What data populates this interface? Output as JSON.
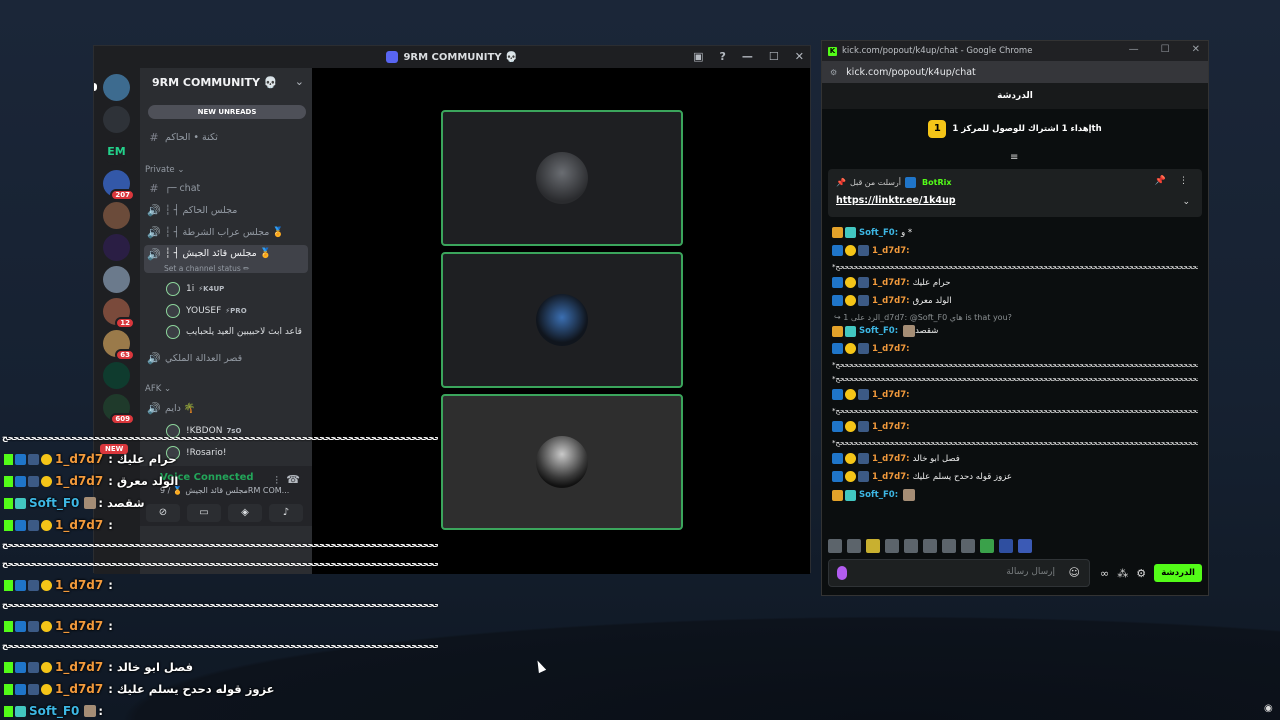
{
  "discord": {
    "window_title": "9RM COMMUNITY 💀",
    "server_name": "9RM COMMUNITY 💀",
    "new_unreads": "NEW UNREADS",
    "guild_badges": [
      "207",
      "12",
      "63",
      "609"
    ],
    "channels_top": [
      {
        "name": "ثكنة • الحاكم",
        "icon": "#"
      }
    ],
    "category_private": "Private ⌄",
    "private_channels": [
      {
        "name": "┌─ chat",
        "icon": "#"
      },
      {
        "name": "┆ ┤ مجلس الحاكم",
        "icon": "🔊"
      },
      {
        "name": "┆ ┤ مجلس عراب الشرطة 🏅",
        "icon": "🔊"
      },
      {
        "name": "┆ ┤ مجلس قائد الجيش 🏅",
        "icon": "🔊"
      }
    ],
    "active_status": "Set a channel status ✏",
    "voice_users": [
      {
        "name": "1i",
        "tag": "⚡K4UP"
      },
      {
        "name": "YOUSEF",
        "tag": "⚡PRO"
      },
      {
        "name": "قاعد ابث لاحبيبين العيد يلحبايب",
        "tag": ""
      }
    ],
    "other_channel": "قصر العدالة الملكي",
    "category_afk": "AFK ⌄",
    "afk_channel": "دايم 🌴",
    "afk_users": [
      {
        "name": "!KBDON",
        "tag": "7sO"
      },
      {
        "name": "!Rosario!",
        "tag": ""
      }
    ],
    "voice_connected": "Voice Connected",
    "voice_detail": "مجلس قائد الجيش 🏅 / 9RM COM...",
    "new_tag": "NEW"
  },
  "kick": {
    "window_title": "kick.com/popout/k4up/chat - Google Chrome",
    "url": "kick.com/popout/k4up/chat",
    "header": "الدردشة",
    "goal_number": "1",
    "goal_text": "إهداء 1 اشتراك للوصول للمركز 1th",
    "pinned_by": "أرسلت من قبل",
    "pinned_bot": "BotRix",
    "pinned_link": "https://linktr.ee/1k4up",
    "messages": [
      {
        "user": "Soft_F0",
        "type": "soft",
        "text": "و *"
      },
      {
        "user": "1_d7d7",
        "type": "dd",
        "text": ""
      },
      {
        "user": "",
        "type": "line",
        "text": "*ححححححححححححححححححححححححححححححححححححححححححححححححححححححححححححححححححححححححححححححححححححححححححح*"
      },
      {
        "user": "1_d7d7",
        "type": "dd",
        "text": "حرام عليك"
      },
      {
        "user": "1_d7d7",
        "type": "dd",
        "text": "الولد معرق"
      },
      {
        "user": "",
        "type": "reply",
        "text": "↪ الرد على 1_d7d7: @Soft_F0 هاي is that you?"
      },
      {
        "user": "Soft_F0",
        "type": "soft",
        "text": "شقصد"
      },
      {
        "user": "1_d7d7",
        "type": "dd",
        "text": ""
      },
      {
        "user": "",
        "type": "line",
        "text": "*ححححححححححححححححححححححححححححححححححححححححححححححححححححححححححححححححححححححححححححححححححححححححححح*"
      },
      {
        "user": "",
        "type": "line",
        "text": "*ححححححححححححححححححححححححححححححححححححححححححححححححححححححححححححححححححححححححححححححححححححححححححح*"
      },
      {
        "user": "1_d7d7",
        "type": "dd",
        "text": ""
      },
      {
        "user": "",
        "type": "line",
        "text": "*ححححححححححححححححححححححححححححححححححححححححححححححححححححححححححححححححححححححححححححححححححححححححححح*"
      },
      {
        "user": "1_d7d7",
        "type": "dd",
        "text": ""
      },
      {
        "user": "",
        "type": "line",
        "text": "*ححححححححححححححححححححححححححححححححححححححححححححححححححححححححححححححححححححححححححححححححححححححححححح*"
      },
      {
        "user": "1_d7d7",
        "type": "dd",
        "text": "فصل ابو خالد"
      },
      {
        "user": "1_d7d7",
        "type": "dd",
        "text": "عزوز قوله دحدح يسلم عليك"
      },
      {
        "user": "Soft_F0",
        "type": "soft",
        "text": ""
      }
    ],
    "input_placeholder": "إرسال رسالة",
    "send_label": "الدردشة"
  },
  "overlay": {
    "lines": [
      {
        "kind": "line",
        "text": "ححححححححححححححححححححححححححححححححححححححححححححححححححححححححححححححححححححححححححححححح"
      },
      {
        "kind": "msg",
        "user": "1_d7d7",
        "text": ": حرام عليك",
        "type": "dd"
      },
      {
        "kind": "msg",
        "user": "1_d7d7",
        "text": ": الولد معرق",
        "type": "dd"
      },
      {
        "kind": "msg",
        "user": "Soft_F0",
        "text": ": شقصد",
        "type": "soft"
      },
      {
        "kind": "msg",
        "user": "1_d7d7",
        "text": ":",
        "type": "dd"
      },
      {
        "kind": "line",
        "text": "ححححححححححححححححححححححححححححححححححححححححححححححححححححححححححححححححححححححححححححححح"
      },
      {
        "kind": "line",
        "text": "ححححححححححححححححححححححححححححححححححححححححححححححححححححححححححححححححححححححححححححححح"
      },
      {
        "kind": "msg",
        "user": "1_d7d7",
        "text": ":",
        "type": "dd"
      },
      {
        "kind": "line",
        "text": "ححححححححححححححححححححححححححححححححححححححححححححححححححححححححححححححححححححححححححححححح"
      },
      {
        "kind": "msg",
        "user": "1_d7d7",
        "text": ":",
        "type": "dd"
      },
      {
        "kind": "line",
        "text": "ححححححححححححححححححححححححححححححححححححححححححححححححححححححححححححححححححححححححححححححح"
      },
      {
        "kind": "msg",
        "user": "1_d7d7",
        "text": ": فصل ابو خالد",
        "type": "dd"
      },
      {
        "kind": "msg",
        "user": "1_d7d7",
        "text": ": عزوز قوله دحدح يسلم عليك",
        "type": "dd"
      },
      {
        "kind": "msg",
        "user": "Soft_F0",
        "text": ":",
        "type": "soft"
      }
    ]
  },
  "colors": {
    "kick_green": "#53fc18",
    "discord_green": "#3ba55c",
    "user_orange": "#f29a3c",
    "user_blue": "#3db7e4"
  }
}
